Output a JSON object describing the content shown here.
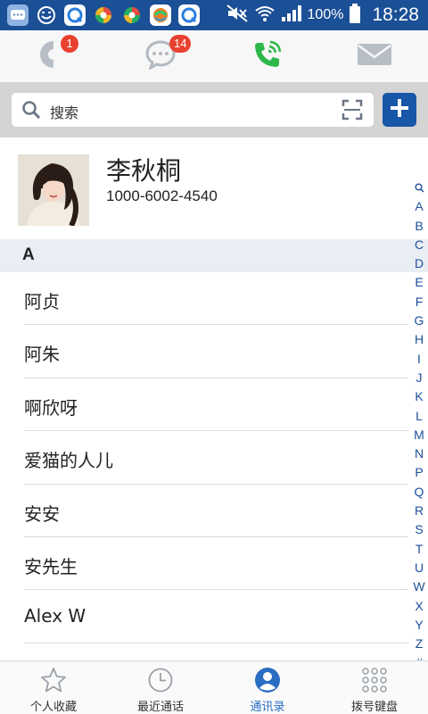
{
  "status_bar": {
    "battery_text": "100%",
    "time": "18:28"
  },
  "top_tabs": [
    {
      "icon": "favorites-chart-icon",
      "badge": "1"
    },
    {
      "icon": "chat-bubble-icon",
      "badge": "14"
    },
    {
      "icon": "phone-call-icon",
      "badge": ""
    },
    {
      "icon": "mail-icon",
      "badge": ""
    }
  ],
  "search": {
    "placeholder": "搜索"
  },
  "profile": {
    "name": "李秋桐",
    "phone": "1000-6002-4540"
  },
  "section_header": "A",
  "contacts": [
    "阿贞",
    "阿朱",
    "啊欣呀",
    "爱猫的人儿",
    "安安",
    "安先生",
    "Alex W"
  ],
  "alphabet": [
    "A",
    "B",
    "C",
    "D",
    "E",
    "F",
    "G",
    "H",
    "I",
    "J",
    "K",
    "L",
    "M",
    "N",
    "P",
    "Q",
    "R",
    "S",
    "T",
    "U",
    "W",
    "X",
    "Y",
    "Z",
    "#"
  ],
  "bottom_nav": [
    {
      "label": "个人收藏",
      "icon": "star-icon"
    },
    {
      "label": "最近通话",
      "icon": "clock-icon"
    },
    {
      "label": "通讯录",
      "icon": "contacts-person-icon",
      "active": true
    },
    {
      "label": "拨号键盘",
      "icon": "dialpad-icon"
    }
  ],
  "colors": {
    "status_bar": "#1b4f96",
    "accent": "#1857a8",
    "badge": "#e8412f",
    "phone_green": "#2db84a",
    "active_tab": "#2b6ec2"
  }
}
